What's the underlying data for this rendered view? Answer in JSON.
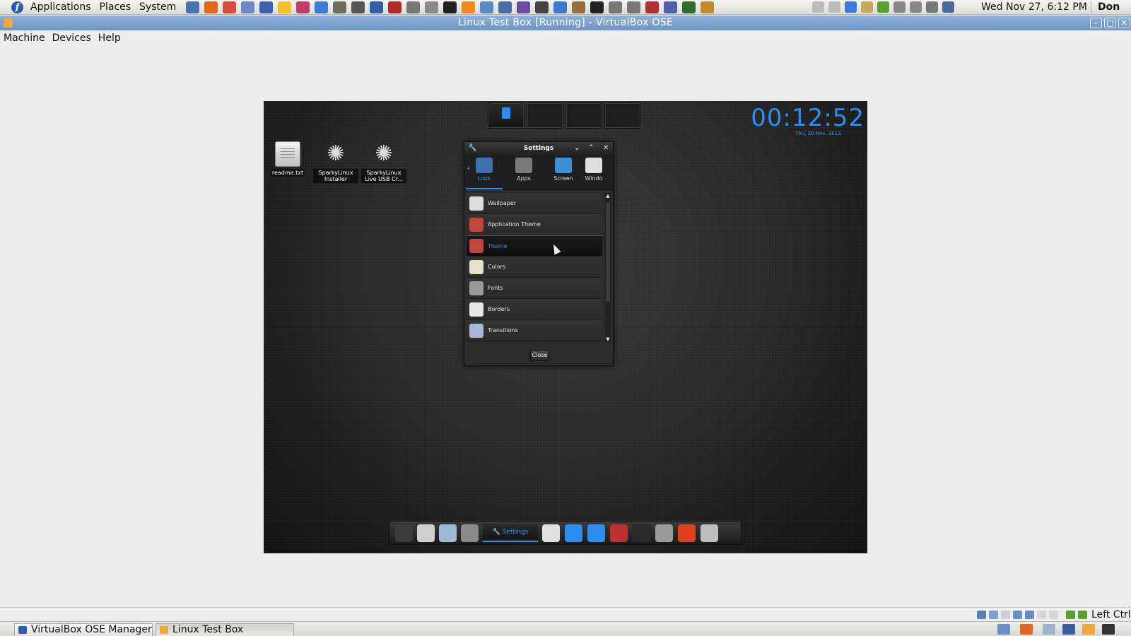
{
  "top_panel": {
    "menus": [
      "Applications",
      "Places",
      "System"
    ],
    "launchers": [
      {
        "icon": "thunderbird-icon",
        "color": "#4a73b6"
      },
      {
        "icon": "firefox-icon",
        "color": "#e3681d"
      },
      {
        "icon": "chrome-icon",
        "color": "#d94c3c"
      },
      {
        "icon": "chat-icon",
        "color": "#6b89c9"
      },
      {
        "icon": "globe-icon",
        "color": "#3b5fb4"
      },
      {
        "icon": "notes-icon",
        "color": "#f4c025"
      },
      {
        "icon": "cube-icon",
        "color": "#c23c64"
      },
      {
        "icon": "sparky-icon",
        "color": "#3a7ad9"
      },
      {
        "icon": "gimp-icon",
        "color": "#6e6c5c"
      },
      {
        "icon": "camera-icon",
        "color": "#555555"
      },
      {
        "icon": "slides-icon",
        "color": "#3060a8"
      },
      {
        "icon": "media-icon",
        "color": "#b02a2a"
      },
      {
        "icon": "webcam-icon",
        "color": "#777777"
      },
      {
        "icon": "network-icon",
        "color": "#8a8a8a"
      },
      {
        "icon": "update-icon",
        "color": "#222222"
      },
      {
        "icon": "vlc-icon",
        "color": "#f08a1c"
      },
      {
        "icon": "writer-icon",
        "color": "#5a88c8"
      },
      {
        "icon": "remote-icon",
        "color": "#4b6da8"
      },
      {
        "icon": "games-icon",
        "color": "#6c4aa3"
      },
      {
        "icon": "calculator-icon",
        "color": "#444444"
      },
      {
        "icon": "feather-icon",
        "color": "#3a7bd0"
      },
      {
        "icon": "archive-icon",
        "color": "#9a6e3a"
      },
      {
        "icon": "terminal-icon",
        "color": "#222222"
      },
      {
        "icon": "binary-icon",
        "color": "#777777"
      },
      {
        "icon": "magnifier-icon",
        "color": "#777777"
      },
      {
        "icon": "tools-icon",
        "color": "#b03030"
      },
      {
        "icon": "pointer-icon",
        "color": "#5060b0"
      },
      {
        "icon": "monitor-icon",
        "color": "#2f6d2f"
      },
      {
        "icon": "search-icon",
        "color": "#c28a2a"
      }
    ],
    "tray": [
      {
        "icon": "notes-tray-icon",
        "color": "#bcbcbc"
      },
      {
        "icon": "clipboard-tray-icon",
        "color": "#bcbcbc"
      },
      {
        "icon": "sparky-tray-icon",
        "color": "#3a7ad9"
      },
      {
        "icon": "clipboard-icon",
        "color": "#c9a85a"
      },
      {
        "icon": "check-icon",
        "color": "#5aa02c"
      },
      {
        "icon": "network-tray-icon",
        "color": "#888888"
      },
      {
        "icon": "mic-icon",
        "color": "#888888"
      },
      {
        "icon": "volume-icon",
        "color": "#777777"
      },
      {
        "icon": "display-tray-icon",
        "color": "#4a6a9a"
      }
    ],
    "clock": "Wed Nov 27,  6:12 PM",
    "user": "Don"
  },
  "vbox_window": {
    "title": "Linux Test Box [Running] - VirtualBox OSE",
    "menus": [
      "Machine",
      "Devices",
      "Help"
    ]
  },
  "guest": {
    "clock": "00:12:52",
    "date": "Thu, 28 Nov, 2013",
    "desktop_icons": [
      {
        "label": "readme.txt",
        "type": "file"
      },
      {
        "label": "SparkyLinux Installer",
        "type": "spiral"
      },
      {
        "label": "SparkyLinux Live USB Cr...",
        "type": "spiral"
      }
    ],
    "settings": {
      "title": "Settings",
      "tabs": [
        {
          "label": "Look",
          "icon": "look-icon",
          "color": "#3b6fb0"
        },
        {
          "label": "Apps",
          "icon": "apps-icon",
          "color": "#7a7a7a"
        },
        {
          "label": "Screen",
          "icon": "screen-icon",
          "color": "#3a8fd8"
        },
        {
          "label": "Windo",
          "icon": "windows-icon",
          "color": "#dddddd"
        }
      ],
      "items": [
        {
          "label": "Wallpaper",
          "icon": "wallpaper-icon",
          "color": "#dcdcdc"
        },
        {
          "label": "Application Theme",
          "icon": "app-theme-icon",
          "color": "#c0453c"
        },
        {
          "label": "Theme",
          "icon": "theme-icon",
          "color": "#c0453c"
        },
        {
          "label": "Colors",
          "icon": "colors-icon",
          "color": "#e8e0c8"
        },
        {
          "label": "Fonts",
          "icon": "fonts-icon",
          "color": "#9a9a9a"
        },
        {
          "label": "Borders",
          "icon": "borders-icon",
          "color": "#e8e8e8"
        },
        {
          "label": "Transitions",
          "icon": "transitions-icon",
          "color": "#a8b8d8"
        }
      ],
      "selected_item": "Theme",
      "close_label": "Close"
    },
    "shelf": {
      "task_label": "Settings",
      "icons": [
        {
          "icon": "shelf-up-icon",
          "color": "#3a3a3a"
        },
        {
          "icon": "shelf-files-icon",
          "color": "#d0d0d0"
        },
        {
          "icon": "shelf-browser-icon",
          "color": "#9fb9d6"
        },
        {
          "icon": "shelf-sparky-icon",
          "color": "#8a8a8a"
        }
      ],
      "icons_after": [
        {
          "icon": "shelf-bulb-icon",
          "color": "#e0e0e0"
        },
        {
          "icon": "shelf-thermometer-icon",
          "color": "#2c8ef0"
        },
        {
          "icon": "shelf-clipboard-icon",
          "color": "#2c8ef0"
        },
        {
          "icon": "shelf-flag-icon",
          "color": "#c03030"
        },
        {
          "icon": "shelf-gauge-icon",
          "color": "#2a2a2a"
        },
        {
          "icon": "shelf-wrench-icon",
          "color": "#9a9a9a"
        },
        {
          "icon": "shelf-power-icon",
          "color": "#e04020"
        },
        {
          "icon": "shelf-desktops-icon",
          "color": "#bdbdbd"
        }
      ]
    }
  },
  "vbox_status": {
    "host_key": "Left Ctrl"
  },
  "bottom_panel": {
    "tasks": [
      {
        "label": "VirtualBox OSE Manager",
        "icon": "virtualbox-icon",
        "color": "#2d5ea8"
      },
      {
        "label": "Linux Test Box [Runnin...",
        "icon": "vm-icon",
        "color": "#f3a73a"
      }
    ]
  },
  "colors": {
    "accent": "#2c8ef0",
    "title_bar": "#7a9dcd"
  }
}
